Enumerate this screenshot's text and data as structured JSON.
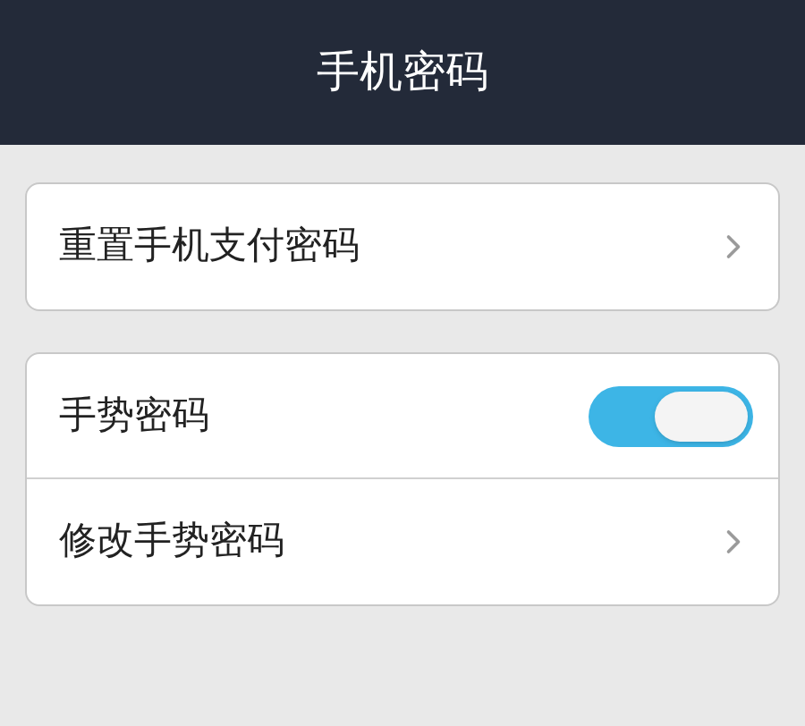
{
  "header": {
    "title": "手机密码"
  },
  "groups": [
    {
      "items": [
        {
          "kind": "link",
          "label": "重置手机支付密码"
        }
      ]
    },
    {
      "items": [
        {
          "kind": "toggle",
          "label": "手势密码",
          "on": true
        },
        {
          "kind": "link",
          "label": "修改手势密码"
        }
      ]
    }
  ]
}
